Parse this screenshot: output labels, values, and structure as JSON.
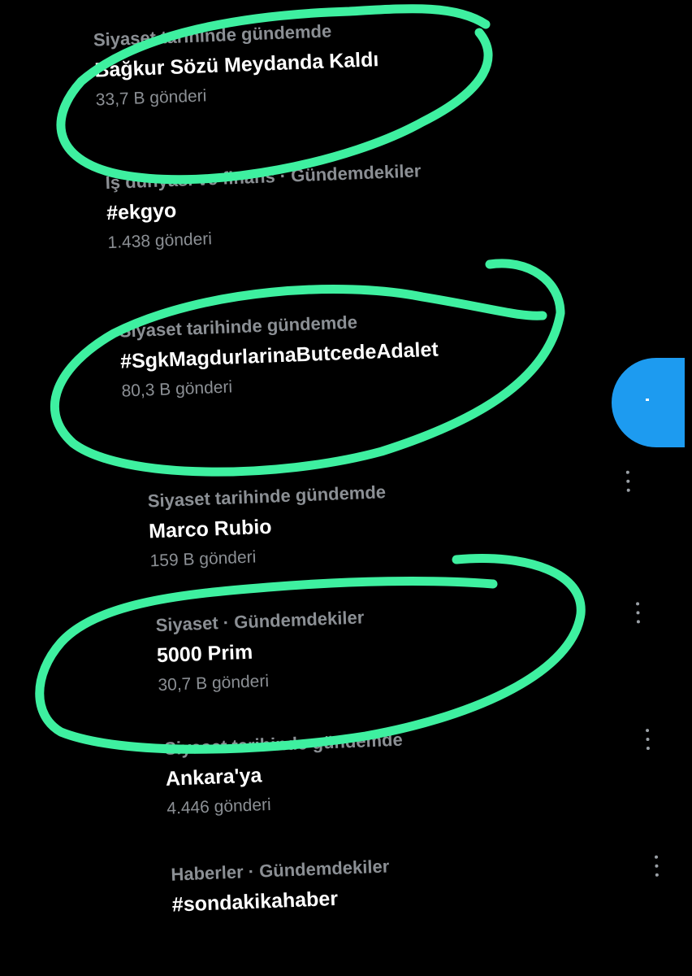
{
  "trends": [
    {
      "category": "Siyaset tarihinde gündemde",
      "title": "Bağkur Sözü Meydanda Kaldı",
      "count": "33,7 B gönderi"
    },
    {
      "category": "İş dünyası ve finans · Gündemdekiler",
      "title": "#ekgyo",
      "count": "1.438 gönderi"
    },
    {
      "category": "Siyaset tarihinde gündemde",
      "title": "#SgkMagdurlarinaButcedeAdalet",
      "count": "80,3 B gönderi"
    },
    {
      "category": "Siyaset tarihinde gündemde",
      "title": "Marco Rubio",
      "count": "159 B gönderi"
    },
    {
      "category": "Siyaset · Gündemdekiler",
      "title": "5000 Prim",
      "count": "30,7 B gönderi"
    },
    {
      "category": "Siyaset tarihinde gündemde",
      "title": "Ankara'ya",
      "count": "4.446 gönderi"
    },
    {
      "category": "Haberler · Gündemdekiler",
      "title": "#sondakikahaber",
      "count": ""
    }
  ],
  "annotation_color": "#3ef0a0",
  "fab_color": "#1d9bf0",
  "icons": {
    "more": "more-vertical-icon"
  }
}
